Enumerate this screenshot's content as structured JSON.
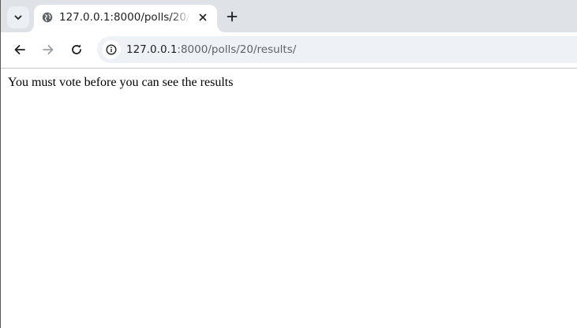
{
  "browser": {
    "tab": {
      "title": "127.0.0.1:8000/polls/20/"
    },
    "address_bar": {
      "host": "127.0.0.1",
      "path": ":8000/polls/20/results/"
    },
    "icons": {
      "tab_search": "chevron-down-icon",
      "favicon": "globe-icon",
      "close": "close-icon",
      "new_tab": "plus-icon",
      "back": "arrow-left-icon",
      "forward": "arrow-right-icon",
      "reload": "reload-icon",
      "site_info": "info-icon"
    }
  },
  "page": {
    "message": "You must vote before you can see the results"
  }
}
